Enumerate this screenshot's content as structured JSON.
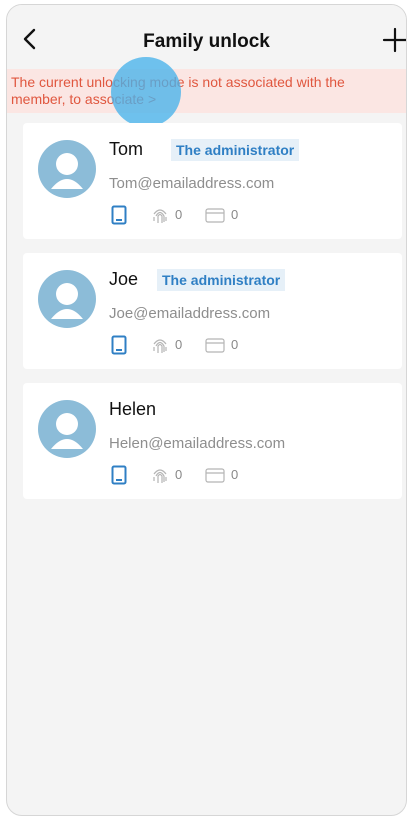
{
  "header": {
    "title": "Family unlock",
    "back_icon": "chevron-left-icon",
    "add_icon": "plus-icon"
  },
  "banner": {
    "message": "The current unlocking mode is not associated with the member,",
    "link": "to associate >"
  },
  "members": [
    {
      "name": "Tom",
      "badge": "The administrator",
      "email": "Tom@emailaddress.com",
      "fingerprint_count": "0",
      "card_count": "0"
    },
    {
      "name": "Joe",
      "badge": "The administrator",
      "email": "Joe@emailaddress.com",
      "fingerprint_count": "0",
      "card_count": "0"
    },
    {
      "name": "Helen",
      "badge": "",
      "email": "Helen@emailaddress.com",
      "fingerprint_count": "0",
      "card_count": "0"
    }
  ],
  "colors": {
    "accent": "#2f7fc4",
    "warning_text": "#e0573f",
    "warning_bg": "#fbe6e3",
    "avatar": "#8cbcd8"
  }
}
